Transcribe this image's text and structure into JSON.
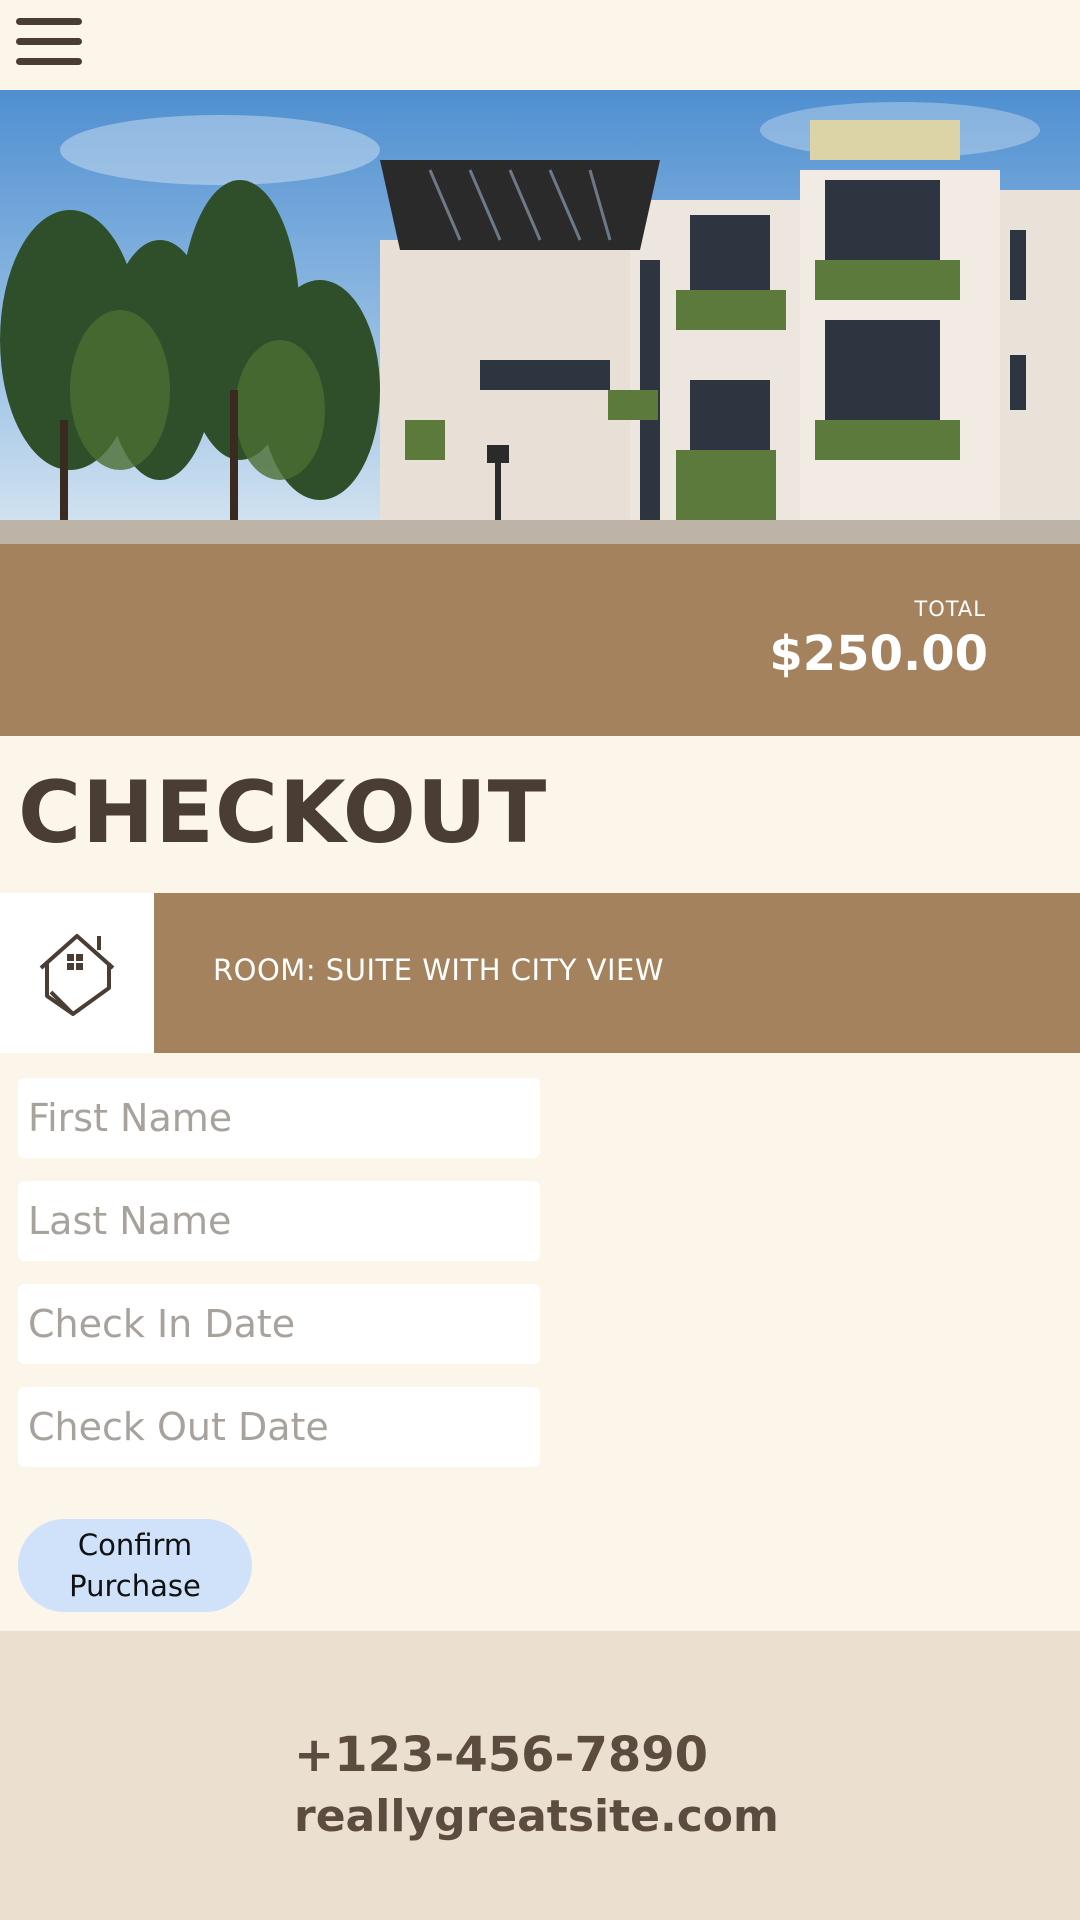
{
  "header": {
    "menu_icon": "hamburger-menu-icon"
  },
  "hero": {
    "image_icon": "building-photo"
  },
  "summary": {
    "total_label": "TOTAL",
    "total_value": "$250.00"
  },
  "page": {
    "title": "CHECKOUT"
  },
  "room": {
    "icon": "house-icon",
    "label": "ROOM: SUITE WITH CITY VIEW"
  },
  "form": {
    "first_name_placeholder": "First Name",
    "last_name_placeholder": "Last Name",
    "check_in_placeholder": "Check In Date",
    "check_out_placeholder": "Check Out Date",
    "confirm_label": "Confirm Purchase"
  },
  "footer": {
    "phone": "+123-456-7890",
    "website": "reallygreatsite.com"
  },
  "colors": {
    "background": "#fcf5ea",
    "accent": "#a4825e",
    "text_dark": "#4a3d33",
    "button": "#cfe2fa",
    "footer_bg": "#ebe0cf"
  }
}
